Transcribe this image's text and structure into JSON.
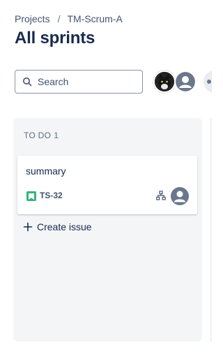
{
  "breadcrumb": {
    "root": "Projects",
    "separator": "/",
    "project": "TM-Scrum-A"
  },
  "page_title": "All sprints",
  "search": {
    "placeholder": "Search",
    "icon": "search-icon"
  },
  "avatars": [
    {
      "icon": "cat-avatar"
    },
    {
      "icon": "user-icon"
    },
    {
      "icon": "user-icon"
    }
  ],
  "column": {
    "name": "TO DO",
    "count": "1",
    "cards": [
      {
        "summary": "summary",
        "issue_type_icon": "story-icon",
        "key": "TS-32",
        "hierarchy_icon": "hierarchy-icon",
        "assignee_icon": "user-icon"
      }
    ],
    "create_label": "Create issue"
  },
  "colors": {
    "column_bg": "#f4f5f7",
    "story": "#36b37e",
    "text": "#172b4d",
    "muted": "#5e6c84"
  }
}
